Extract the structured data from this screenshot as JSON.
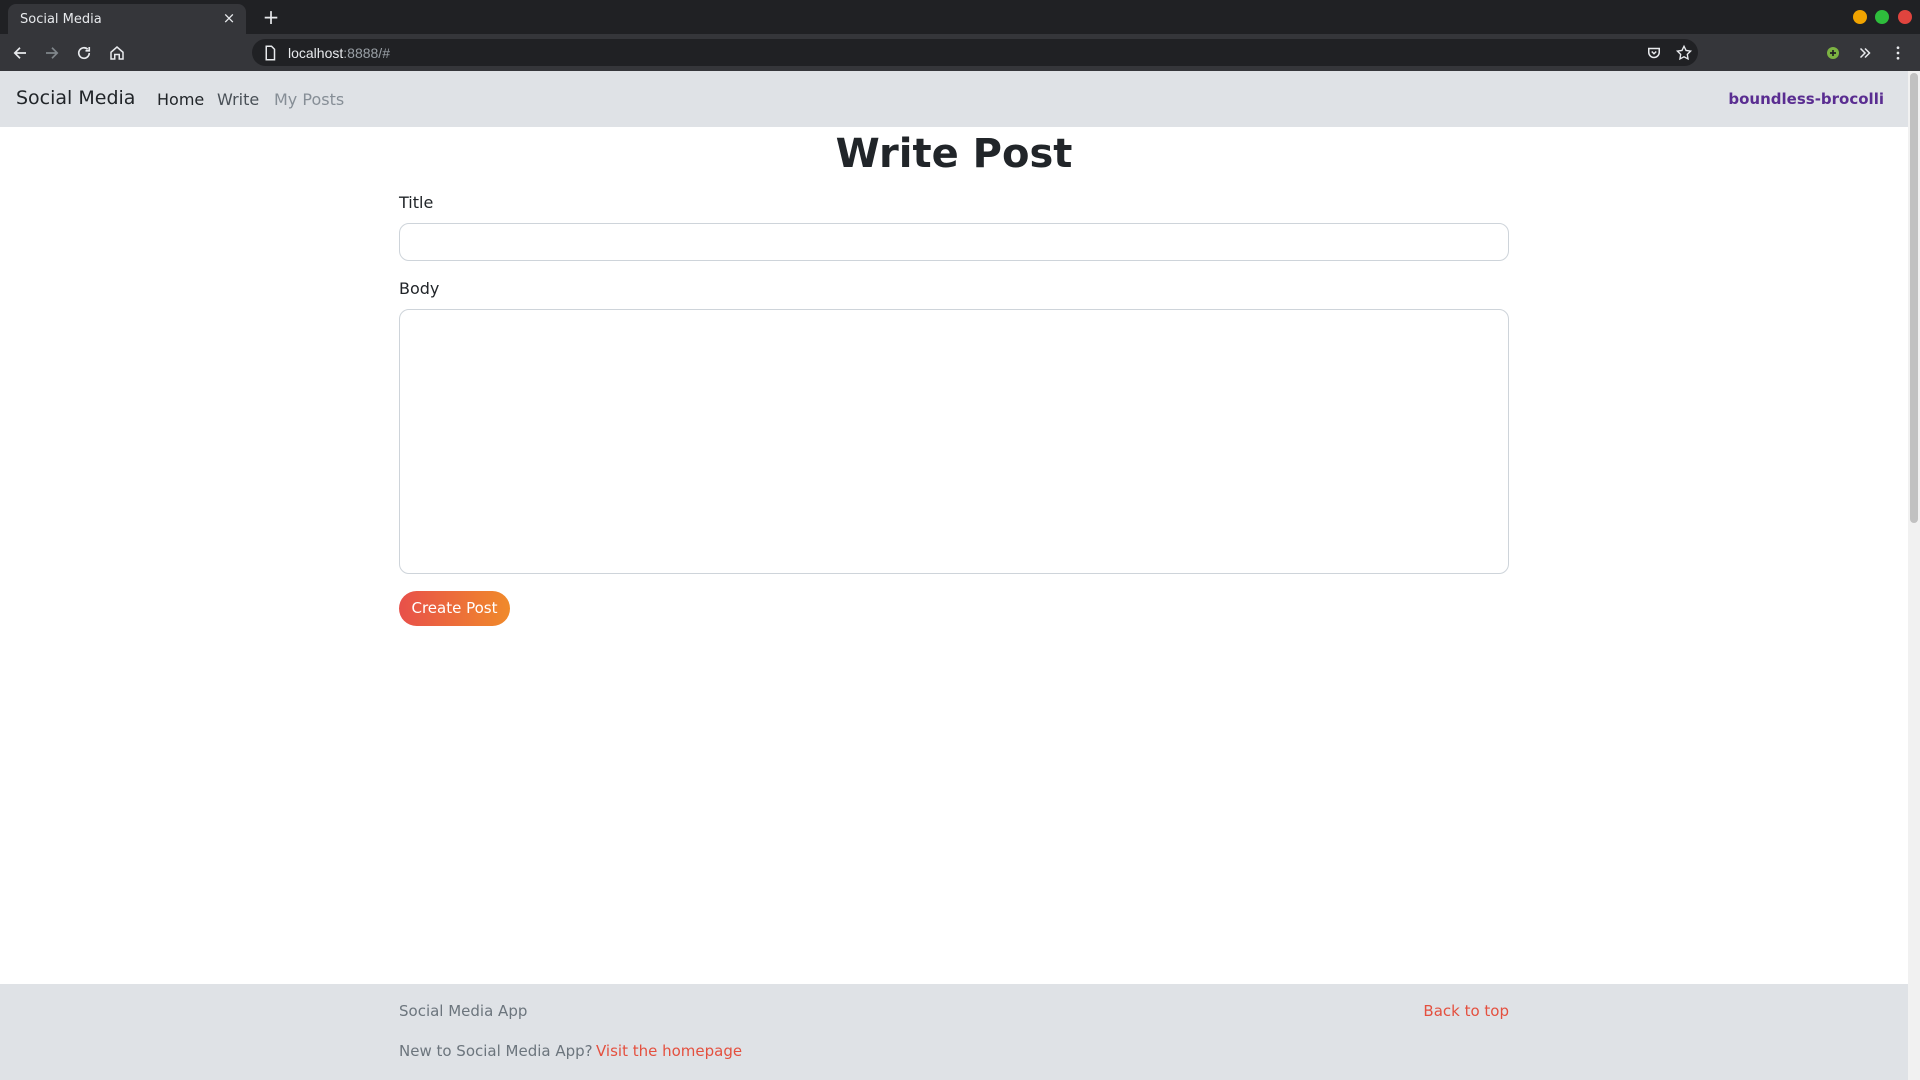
{
  "browser": {
    "tab_title": "Social Media",
    "tab_close": "×",
    "new_tab": "+",
    "url_host": "localhost",
    "url_rest": ":8888/#",
    "window_buttons": [
      "#f0a300",
      "#2ebd3c",
      "#e0443e"
    ]
  },
  "navbar": {
    "brand": "Social Media",
    "links": [
      {
        "label": "Home",
        "color": "#212529"
      },
      {
        "label": "Write",
        "color": "#495057"
      },
      {
        "label": "My Posts",
        "color": "#868e96"
      }
    ],
    "user": "boundless-brocolli"
  },
  "form": {
    "heading": "Write Post",
    "title_label": "Title",
    "title_value": "",
    "body_label": "Body",
    "body_value": "",
    "submit_label": "Create Post"
  },
  "footer": {
    "app_name": "Social Media App",
    "back_to_top": "Back to top",
    "new_prompt": "New to Social Media App?",
    "visit_link": "Visit the homepage"
  }
}
